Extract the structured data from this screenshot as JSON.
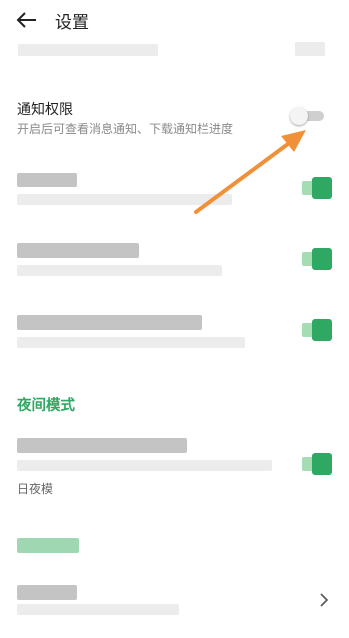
{
  "header": {
    "title": "设置",
    "back_icon": "arrow-left-icon"
  },
  "notification": {
    "title": "通知权限",
    "subtitle": "开启后可查看消息通知、下载通知栏进度",
    "toggle_state": "off"
  },
  "night_mode": {
    "section_title": "夜间模式",
    "row_sub_visible": "日夜模"
  },
  "colors": {
    "accent_green": "#2ea862",
    "annotation_arrow": "#f0913a"
  },
  "icons": {
    "chevron": "chevron-right-icon"
  }
}
